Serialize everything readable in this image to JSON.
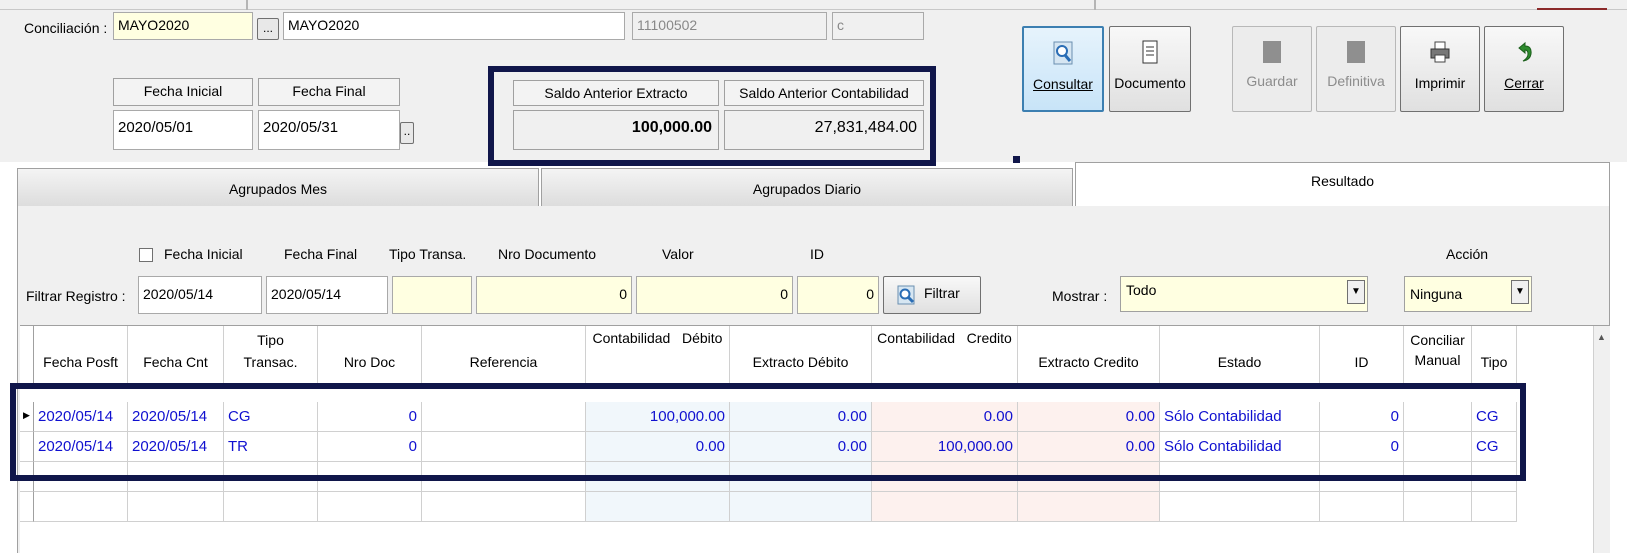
{
  "conciliacion": {
    "label": "Conciliación :",
    "code": "MAYO2020",
    "browse": "...",
    "name": "MAYO2020",
    "account": "11100502",
    "type": "c"
  },
  "dates": {
    "start_label": "Fecha Inicial",
    "end_label": "Fecha Final",
    "start_value": "2020/05/01",
    "end_value": "2020/05/31",
    "picker": ".."
  },
  "balances": {
    "extracto_label": "Saldo Anterior  Extracto",
    "contabilidad_label": "Saldo Anterior  Contabilidad",
    "extracto_value": "100,000.00",
    "contabilidad_value": "27,831,484.00"
  },
  "toolbar": {
    "consultar": "Consultar",
    "documento": "Documento",
    "guardar": "Guardar",
    "definitiva": "Definitiva",
    "imprimir": "Imprimir",
    "cerrar": "Cerrar"
  },
  "tabs": [
    "Agrupados Mes",
    "Agrupados Diario",
    "Resultado"
  ],
  "filter": {
    "fecha_inicial_label": "Fecha Inicial",
    "fecha_final_label": "Fecha Final",
    "tipo_label": "Tipo Transa.",
    "nro_label": "Nro Documento",
    "valor_label": "Valor",
    "id_label": "ID",
    "accion_label": "Acción",
    "row_label": "Filtrar Registro :",
    "fecha_inicial": "2020/05/14",
    "fecha_final": "2020/05/14",
    "tipo": "",
    "nro": "0",
    "valor": "0",
    "id": "0",
    "button": "Filtrar",
    "mostrar_label": "Mostrar :",
    "mostrar_value": "Todo",
    "accion_value": "Ninguna"
  },
  "grid": {
    "headers": {
      "fecha_posft": "Fecha Posft",
      "fecha_cnt": "Fecha Cnt",
      "tipo_1": "Tipo",
      "tipo_2": "Transac.",
      "nro_doc": "Nro Doc",
      "referencia": "Referencia",
      "cont_debito": "Contabilidad   Débito",
      "ext_debito": "Extracto Débito",
      "cont_credito": "Contabilidad   Credito",
      "ext_credito": "Extracto Credito",
      "estado": "Estado",
      "id": "ID",
      "conciliar_1": "Conciliar",
      "conciliar_2": "Manual",
      "tipo": "Tipo"
    },
    "rows": [
      {
        "fecha_posft": "2020/05/14",
        "fecha_cnt": "2020/05/14",
        "tipo_transac": "CG",
        "nro_doc": "0",
        "referencia": "",
        "cont_debito": "100,000.00",
        "ext_debito": "0.00",
        "cont_credito": "0.00",
        "ext_credito": "0.00",
        "estado": "Sólo Contabilidad",
        "id": "0",
        "conciliar": "",
        "tipo": "CG"
      },
      {
        "fecha_posft": "2020/05/14",
        "fecha_cnt": "2020/05/14",
        "tipo_transac": "TR",
        "nro_doc": "0",
        "referencia": "",
        "cont_debito": "0.00",
        "ext_debito": "0.00",
        "cont_credito": "100,000.00",
        "ext_credito": "0.00",
        "estado": "Sólo Contabilidad",
        "id": "0",
        "conciliar": "",
        "tipo": "CG"
      }
    ]
  },
  "colors": {
    "highlight_box": "#10164a",
    "row_text": "#1010d0",
    "field_yellow": "#ffffe1",
    "debit_column": "#f1f7fb",
    "credit_column": "#fdf1ee"
  },
  "icons": {
    "consultar": "magnifier-icon",
    "documento": "document-icon",
    "imprimir": "printer-icon",
    "cerrar": "undo-arrow-icon",
    "filtrar": "magnifier-icon"
  }
}
